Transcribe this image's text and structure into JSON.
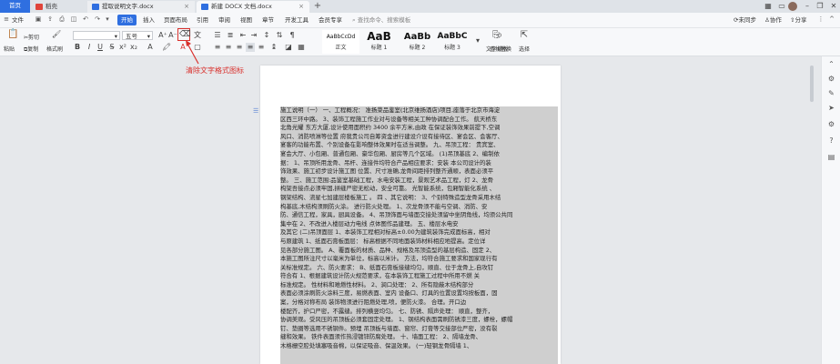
{
  "tabs": {
    "home": "首页",
    "docer": "稻壳",
    "doc1": "提取说明文字.docx",
    "doc2": "新建 DOCX 文档.docx",
    "plus": "+"
  },
  "menu": {
    "file": "文件",
    "start": "开始",
    "insert": "插入",
    "layout": "页面布局",
    "reference": "引用",
    "review": "审阅",
    "view": "视图",
    "chapter": "章节",
    "dev": "开发工具",
    "member": "会员专享",
    "search_placeholder": "查找命令、搜索模板",
    "unsynced": "未同步",
    "collab": "协作",
    "share": "分享"
  },
  "ribbon": {
    "cut": "剪切",
    "paste": "粘贴",
    "copy": "复制",
    "format_painter": "格式刷",
    "font_size": "五号",
    "bold": "B",
    "italic": "I",
    "underline": "U",
    "styles": [
      {
        "preview": "AaBbCcDd",
        "label": "正文"
      },
      {
        "preview": "AaB",
        "label": "标题 1"
      },
      {
        "preview": "AaBb",
        "label": "标题 2"
      },
      {
        "preview": "AaBbC",
        "label": "标题 3"
      }
    ],
    "text_layout": "文字排版",
    "find_replace": "查找替换",
    "select": "选择"
  },
  "annotation": "清除文字格式图标",
  "colors": {
    "accent": "#2f6fe0",
    "annotation": "#d9302c",
    "highlight": "#cfcfcf"
  },
  "document_lines": [
    "施工说明（一）        一、工程概况：                  准扬菜品鉴室(北京维扬酒店)项目,座落于北京市海淀",
    "区西三环中路。        3、装饰工程施工作业对与设备等相关工种协调配合工作。          航天桥东",
    "北角光耀 东方大厦,设计使用面积约 3400 余平方米,由政           在保证装饰效果前提下,空调",
    "风口、消防喷淋等位置           府我贵公司自筹资金进行建设介设有接待区、宴会区、会客厅、",
    "宴客的功能布置、个别设备在影响整体效果时在适当调整。     九、吊顶工程：           贵宾室、",
    "宴会大厅、小包厢、普通包厢、豪华包厢、厨房等几个区域。     (1)吊顶基底     2、编制依",
    "据：      1、吊顶所用龙骨、吊杆、连接件均符合产品相应要求：安装          本公司设计的装",
    "饰效果、施工初步设计施工图          位置、尺寸准确,龙骨间距排列整齐通顺，表面必须平",
    "整。    三、施工范围:品鉴室基础工程，水电安装工程，景观艺术品工程，灯    2、龙骨",
    "构架吾接点必须牢固,拼缝严密无松动，安全可靠。            光智能系统，包厢智能化系统 、",
    "钢架结构、流星七加建层楼板施工 。       四 、其它说明：            3、个别特殊造型龙骨采用木结",
    "构基底,木结构须刷防火涂。             进行防火处理。           1、次龙骨须不能与空调、消防、安",
    "防、通信工程，家具，厨具设备。          4、吊顶饰面与墙面交接处须留中坐阴角线，均须公共同",
    "集中在         2、不改进入楼层动力电线               点体图作品建理。      五、楼层水电安",
    "及其它    (二)吊顶面层         1、本装饰工程相对标高±0.00为建筑装饰完成面标高，相对",
    "与原建筑         1、纸面石膏板面层：           标高根据不同地面装饰材料相应地提高。定位详",
    "见各部分施工图。        A、覆面板的材质、品种、规格及吊顶造型的基层构造、固定        2、",
    "本施工图所注尺寸以毫米为单位，标高以米计。              方法，均符合施工要求和国家现行有",
    "关标准规定。      六、防火要求：            B、纸面石膏板接缝均匀，顺直、位于龙骨上,自攻钉",
    "符合有      1、根据建筑设计防火规范要求，在本装饰工程施工过程中所用不燃            关",
    "标准规定。         性材料和难燃性材料。          2、涧口处理：          2、所有隐蔽木结构部分",
    "表面必须涂刷防火涂料三度，易燃表面、室内              设备口、灯具的位置设置均按板面，固",
    "案，分格对称布局            装饰物须进行阻燃处理,喷，便防火漆。                     合理。开口边",
    "楼配齐，护口严密，不露缝。排列横竖均匀。     七、防锈、隔声处理：            顺直，整齐，",
    "协调美观。受风压的吊顶板必须套固定处理。         1、钢结构表面需刷防锈漆三度，螺栓，螺帽",
    "钉、垫圈等选用不锈钢件。预埋              吊顶板与墙面、窗帘、灯膏等交接部位严密，没有裂",
    "缝和效果。           铁件表面须作热浸镀锌防腐处理。            十、墙面工程：         2、隔墙龙骨、",
    "木格栅空腔处填塞吸音棉，以保证吸音、保温效果。        (一)轻钢龙骨隔墙              1、"
  ]
}
